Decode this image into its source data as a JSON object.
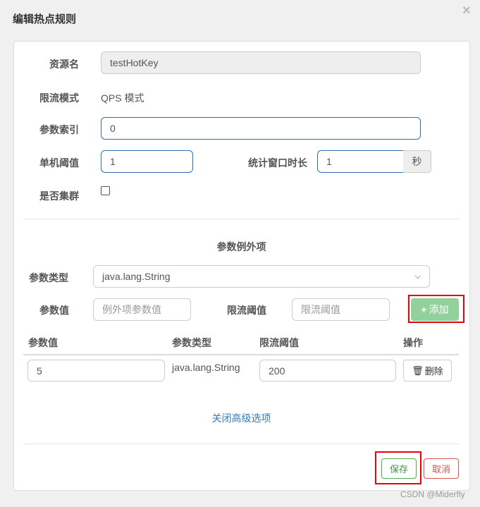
{
  "dialog": {
    "title": "编辑热点规则",
    "close": "×"
  },
  "form": {
    "resource_label": "资源名",
    "resource_value": "testHotKey",
    "mode_label": "限流模式",
    "mode_value": "QPS 模式",
    "index_label": "参数索引",
    "index_value": "0",
    "threshold_label": "单机阈值",
    "threshold_value": "1",
    "window_label": "统计窗口时长",
    "window_value": "1",
    "window_unit": "秒",
    "cluster_label": "是否集群",
    "cluster_checked": false
  },
  "exceptions": {
    "title": "参数例外项",
    "type_label": "参数类型",
    "type_value": "java.lang.String",
    "value_label": "参数值",
    "value_placeholder": "例外项参数值",
    "limit_label": "限流阈值",
    "limit_placeholder": "限流阈值",
    "add_label": "添加",
    "columns": [
      "参数值",
      "参数类型",
      "限流阈值",
      "操作"
    ],
    "rows": [
      {
        "value": "5",
        "type": "java.lang.String",
        "limit": "200",
        "action": "删除"
      }
    ],
    "toggle_link": "关闭高级选项"
  },
  "footer": {
    "save": "保存",
    "cancel": "取消"
  },
  "watermark": "CSDN @Miderfly"
}
